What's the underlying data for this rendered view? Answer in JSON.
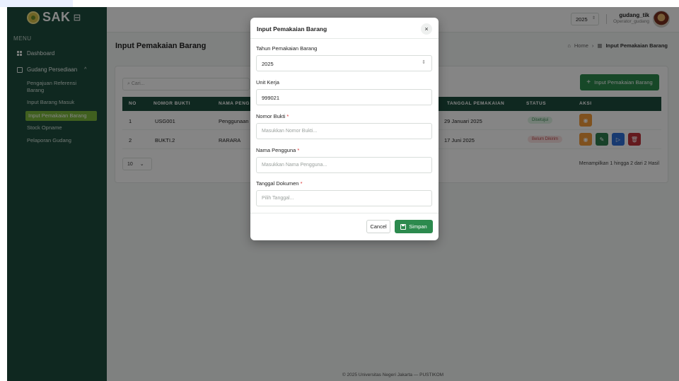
{
  "sidebar": {
    "logo_text": "SAK",
    "menu_label": "MENU",
    "dashboard": "Dashboard",
    "gudang": "Gudang Persediaan",
    "sub": [
      "Pengajuan Referensi Barang",
      "Input Barang Masuk",
      "Input Pemakaian Barang",
      "Stock Opname",
      "Pelaporan Gudang"
    ]
  },
  "topbar": {
    "year": "2025",
    "user_name": "gudang_tik",
    "user_role": "Operator_gudang"
  },
  "page": {
    "title": "Input Pemakaian Barang",
    "breadcrumb_home": "Home",
    "breadcrumb_current": "Input Pemakaian Barang"
  },
  "card": {
    "search_placeholder": "Cari...",
    "add_button": "Input Pemakaian Barang",
    "headers": [
      "NO",
      "NOMOR BUKTI",
      "NAMA PENG",
      "TANGGAL PEMAKAIAN",
      "STATUS",
      "AKSI"
    ],
    "rows": [
      {
        "no": "1",
        "bukti": "USG001",
        "nama": "Penggunaan",
        "tanggal": "29 Januari 2025",
        "status": "Disetujui"
      },
      {
        "no": "2",
        "bukti": "BUKTI.2",
        "nama": "RARARA",
        "tanggal": "17 Juni 2025",
        "status": "Belum Dikirim"
      }
    ],
    "page_size": "10",
    "pager_info": "Menampilkan 1 hingga 2 dari 2 Hasil"
  },
  "footer": "© 2025 Universitas Negeri Jakarta — PUSTIKOM",
  "modal": {
    "title": "Input Pemakaian Barang",
    "close": "×",
    "tahun_label": "Tahun Pemakaian Barang",
    "tahun_value": "2025",
    "unit_label": "Unit Kerja",
    "unit_value": "999021",
    "nomor_label": "Nomor Bukti",
    "nomor_placeholder": "Masukkan Nomor Bukti...",
    "nama_label": "Nama Pengguna",
    "nama_placeholder": "Masukkan Nama Pengguna...",
    "tanggal_label": "Tanggal Dokumen",
    "tanggal_placeholder": "Pilih Tanggal...",
    "required_mark": "*",
    "cancel": "Cancel",
    "save": "Simpan"
  },
  "colors": {
    "sidebar": "#1e4d3f",
    "accent": "#2c8a4e",
    "active_item": "#7bb83d"
  }
}
